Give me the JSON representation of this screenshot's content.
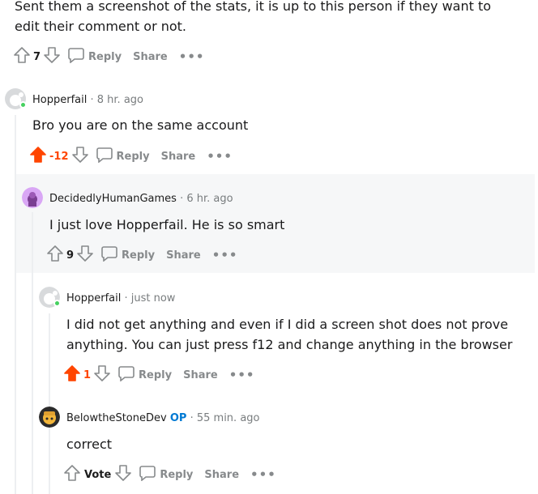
{
  "comment0": {
    "text": "Sent them a screenshot of the stats, it is up to this person if they want to edit their comment or not.",
    "votes": "7",
    "reply": "Reply",
    "share": "Share",
    "more": "•••"
  },
  "comment1": {
    "author": "Hopperfail",
    "sep": "·",
    "time": "8 hr. ago",
    "text": "Bro you are on the same account",
    "votes": "-12",
    "reply": "Reply",
    "share": "Share",
    "more": "•••"
  },
  "comment2": {
    "author": "DecidedlyHumanGames",
    "sep": "·",
    "time": "6 hr. ago",
    "text": "I just love Hopperfail. He is so smart",
    "votes": "9",
    "reply": "Reply",
    "share": "Share",
    "more": "•••"
  },
  "comment3": {
    "author": "Hopperfail",
    "sep": "·",
    "time": "just now",
    "text_line1": "I did not get anything and even if I did a screen shot does not prove",
    "text_line2": "anything. You can just press f12 and change anything in the browser",
    "votes": "1",
    "reply": "Reply",
    "share": "Share",
    "more": "•••"
  },
  "comment4": {
    "author": "BelowtheStoneDev",
    "op": "OP",
    "sep": "·",
    "time": "55 min. ago",
    "text": "correct",
    "votes": "Vote",
    "reply": "Reply",
    "share": "Share",
    "more": "•••"
  },
  "colors": {
    "upvote_active": "#ff4500",
    "op_badge": "#0079d3",
    "online_dot": "#46d160",
    "highlight_bg": "#f6f7f8"
  }
}
